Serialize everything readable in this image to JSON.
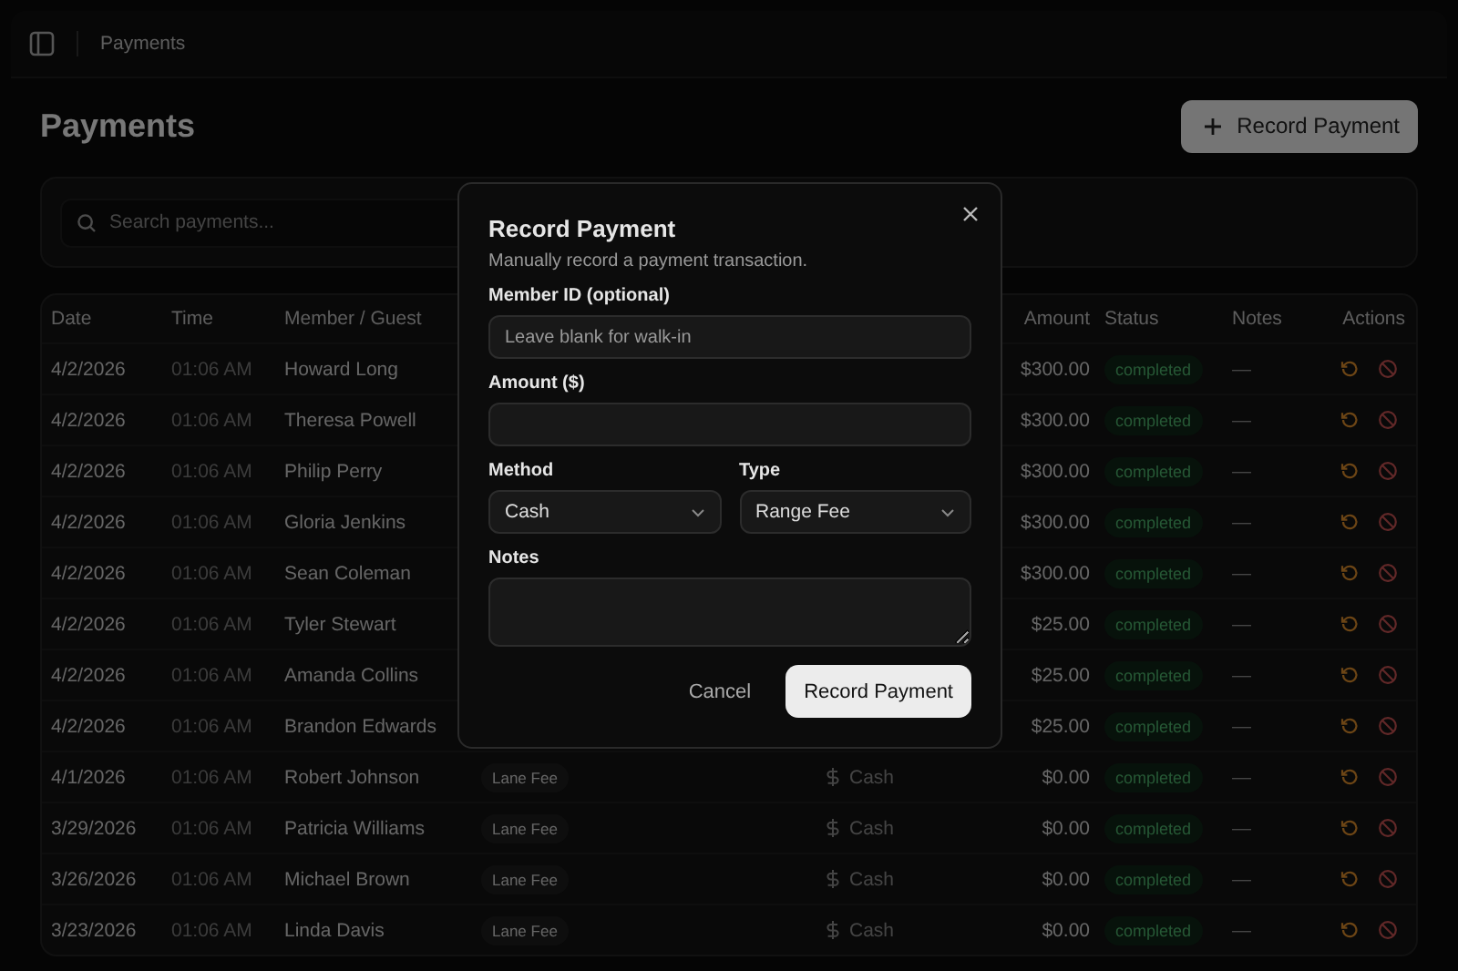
{
  "topbar": {
    "breadcrumb": "Payments"
  },
  "page": {
    "title": "Payments",
    "record_button": "Record Payment"
  },
  "search": {
    "placeholder": "Search payments..."
  },
  "table": {
    "columns": [
      "Date",
      "Time",
      "Member / Guest",
      "Amount",
      "Status",
      "Notes",
      "Actions"
    ],
    "rows": [
      {
        "date": "4/2/2026",
        "time": "01:06 AM",
        "member": "Howard Long",
        "amount": "$300.00",
        "status": "completed",
        "notes": "—"
      },
      {
        "date": "4/2/2026",
        "time": "01:06 AM",
        "member": "Theresa Powell",
        "amount": "$300.00",
        "status": "completed",
        "notes": "—"
      },
      {
        "date": "4/2/2026",
        "time": "01:06 AM",
        "member": "Philip Perry",
        "amount": "$300.00",
        "status": "completed",
        "notes": "—"
      },
      {
        "date": "4/2/2026",
        "time": "01:06 AM",
        "member": "Gloria Jenkins",
        "amount": "$300.00",
        "status": "completed",
        "notes": "—"
      },
      {
        "date": "4/2/2026",
        "time": "01:06 AM",
        "member": "Sean Coleman",
        "amount": "$300.00",
        "status": "completed",
        "notes": "—"
      },
      {
        "date": "4/2/2026",
        "time": "01:06 AM",
        "member": "Tyler Stewart",
        "amount": "$25.00",
        "status": "completed",
        "notes": "—"
      },
      {
        "date": "4/2/2026",
        "time": "01:06 AM",
        "member": "Amanda Collins",
        "amount": "$25.00",
        "status": "completed",
        "notes": "—"
      },
      {
        "date": "4/2/2026",
        "time": "01:06 AM",
        "member": "Brandon Edwards",
        "amount": "$25.00",
        "status": "completed",
        "notes": "—"
      },
      {
        "date": "4/1/2026",
        "time": "01:06 AM",
        "member": "Robert Johnson",
        "type": "Lane Fee",
        "method": "Cash",
        "amount": "$0.00",
        "status": "completed",
        "notes": "—"
      },
      {
        "date": "3/29/2026",
        "time": "01:06 AM",
        "member": "Patricia Williams",
        "type": "Lane Fee",
        "method": "Cash",
        "amount": "$0.00",
        "status": "completed",
        "notes": "—"
      },
      {
        "date": "3/26/2026",
        "time": "01:06 AM",
        "member": "Michael Brown",
        "type": "Lane Fee",
        "method": "Cash",
        "amount": "$0.00",
        "status": "completed",
        "notes": "—"
      },
      {
        "date": "3/23/2026",
        "time": "01:06 AM",
        "member": "Linda Davis",
        "type": "Lane Fee",
        "method": "Cash",
        "amount": "$0.00",
        "status": "completed",
        "notes": "—"
      }
    ]
  },
  "dialog": {
    "title": "Record Payment",
    "description": "Manually record a payment transaction.",
    "member_label": "Member ID (optional)",
    "member_placeholder": "Leave blank for walk-in",
    "amount_label": "Amount ($)",
    "method_label": "Method",
    "method_value": "Cash",
    "type_label": "Type",
    "type_value": "Range Fee",
    "notes_label": "Notes",
    "cancel": "Cancel",
    "submit": "Record Payment"
  }
}
